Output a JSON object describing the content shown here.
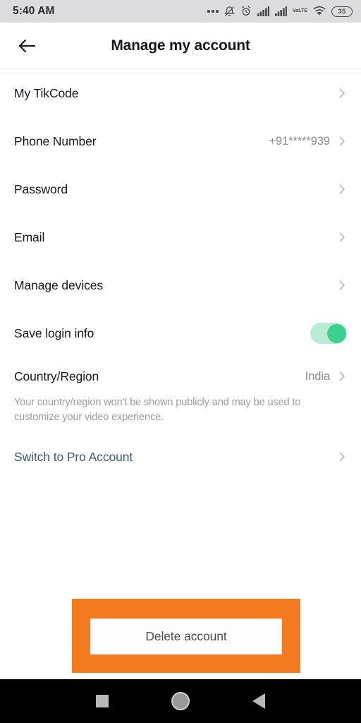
{
  "status_bar": {
    "time": "5:40 AM",
    "battery_level": "35",
    "volte_label_top": "Vo",
    "volte_label_bottom": "LTE",
    "icons": [
      "more-dots-icon",
      "bell-muted-icon",
      "alarm-clock-icon",
      "signal-bars-icon",
      "signal-bars-icon",
      "volte-icon",
      "wifi-icon",
      "battery-icon"
    ],
    "background": "#dcdcde"
  },
  "header": {
    "title": "Manage my account",
    "back_icon": "arrow-left-icon"
  },
  "settings": {
    "rows": [
      {
        "label": "My TikCode",
        "value": ""
      },
      {
        "label": "Phone Number",
        "value": "+91*****939"
      },
      {
        "label": "Password",
        "value": ""
      },
      {
        "label": "Email",
        "value": ""
      },
      {
        "label": "Manage devices",
        "value": ""
      }
    ],
    "save_login": {
      "label": "Save login info",
      "toggle_state": "on",
      "track_color": "#b9ecd4",
      "thumb_color": "#3fcf8e"
    },
    "country": {
      "label": "Country/Region",
      "value": "India",
      "description": "Your country/region won't be shown publicly and may be used to customize your video experience."
    },
    "pro_account": {
      "label": "Switch to Pro Account",
      "color": "#3c5a73"
    }
  },
  "delete_account": {
    "label": "Delete account",
    "highlight_color": "#f47a20"
  },
  "nav_bar": {
    "recents_label": "recents-square",
    "home_label": "home-circle",
    "back_label": "back-triangle",
    "background": "#000000"
  }
}
